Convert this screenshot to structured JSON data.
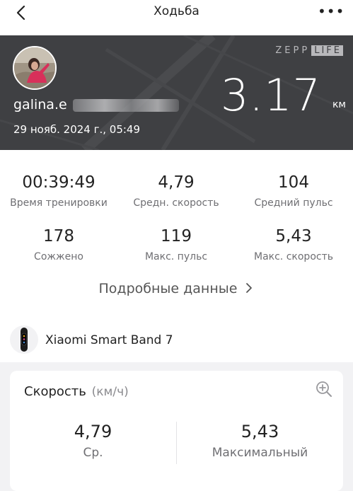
{
  "header": {
    "title": "Ходьба",
    "back_icon": "chevron-left-icon",
    "more_icon": "more-dots-icon",
    "more_glyph": "•••"
  },
  "workout": {
    "brand_left": "ZEPP",
    "brand_right": "LIFE",
    "username": "galina.e",
    "datetime": "29 нояб. 2024 г., 05:49",
    "distance": "3.17",
    "distance_unit": "км"
  },
  "stats": [
    {
      "value": "00:39:49",
      "label": "Время тренировки"
    },
    {
      "value": "4,79",
      "label": "Средн. скорость"
    },
    {
      "value": "104",
      "label": "Средний пульс"
    },
    {
      "value": "178",
      "label": "Сожжено"
    },
    {
      "value": "119",
      "label": "Макс. пульс"
    },
    {
      "value": "5,43",
      "label": "Макс. скорость"
    }
  ],
  "details_link": "Подробные данные",
  "device": {
    "name": "Xiaomi Smart Band 7"
  },
  "speed_card": {
    "title": "Скорость",
    "unit": "(км/ч)",
    "avg_value": "4,79",
    "avg_label": "Ср.",
    "max_value": "5,43",
    "max_label": "Максимальный"
  },
  "colors": {
    "hero_bg": "#3f4043",
    "page_bg": "#f2f2f4",
    "card_bg": "#ffffff"
  }
}
